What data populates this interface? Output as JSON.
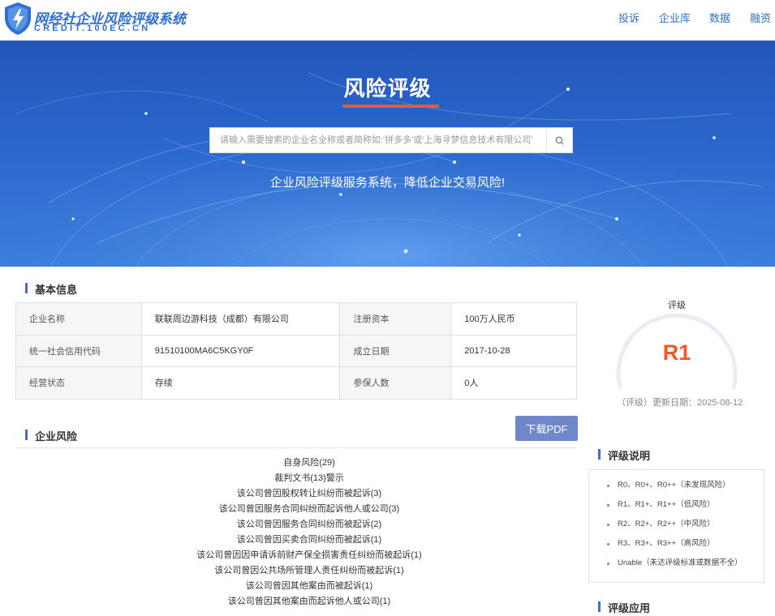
{
  "header": {
    "brand_cn": "网经社企业风险评级系统",
    "brand_en": "CREDIT.100EC.CN",
    "nav": [
      "投诉",
      "企业库",
      "数据",
      "融资"
    ]
  },
  "banner": {
    "title": "风险评级",
    "search_placeholder": "请输入需要搜索的企业名全称或者简称如:'拼多多'或'上海寻梦信息技术有限公司'",
    "subtitle": "企业风险评级服务系统，降低企业交易风险!"
  },
  "basic_info": {
    "title": "基本信息",
    "rows": [
      {
        "k1": "企业名称",
        "v1": "联联周边游科技（成都）有限公司",
        "k2": "注册资本",
        "v2": "100万人民币"
      },
      {
        "k1": "统一社会信用代码",
        "v1": "91510100MA6C5KGY0F",
        "k2": "成立日期",
        "v2": "2017-10-28"
      },
      {
        "k1": "经营状态",
        "v1": "存续",
        "k2": "参保人数",
        "v2": "0人"
      }
    ]
  },
  "rating": {
    "label": "评级",
    "value": "R1",
    "update_text": "（评级）更新日期：2025-08-12"
  },
  "risk": {
    "title": "企业风险",
    "pdf_button": "下载PDF",
    "items": [
      "自身风险(29)",
      "裁判文书(13)警示",
      "该公司曾因股权转让纠纷而被起诉(3)",
      "该公司曾因服务合同纠纷而起诉他人或公司(3)",
      "该公司曾因服务合同纠纷而被起诉(2)",
      "该公司曾因买卖合同纠纷而被起诉(1)",
      "该公司曾因因申请诉前财产保全损害责任纠纷而被起诉(1)",
      "该公司曾因公共场所管理人责任纠纷而被起诉(1)",
      "该公司曾因其他案由而被起诉(1)",
      "该公司曾因其他案由而起诉他人或公司(1)"
    ]
  },
  "rating_explain": {
    "title": "评级说明",
    "items": [
      "R0、R0+、R0++（未发现风险）",
      "R1、R1+、R1++（低风险）",
      "R2、R2+、R2++（中风险）",
      "R3、R3+、R3++（高风险）",
      "Unable（未达评级标准或数据不全）"
    ]
  },
  "rating_apply": {
    "title": "评级应用"
  },
  "colors": {
    "brand": "#2f6fd0",
    "accent": "#e85a2c",
    "rating": "#ef5a24",
    "button": "#6f88c9"
  }
}
